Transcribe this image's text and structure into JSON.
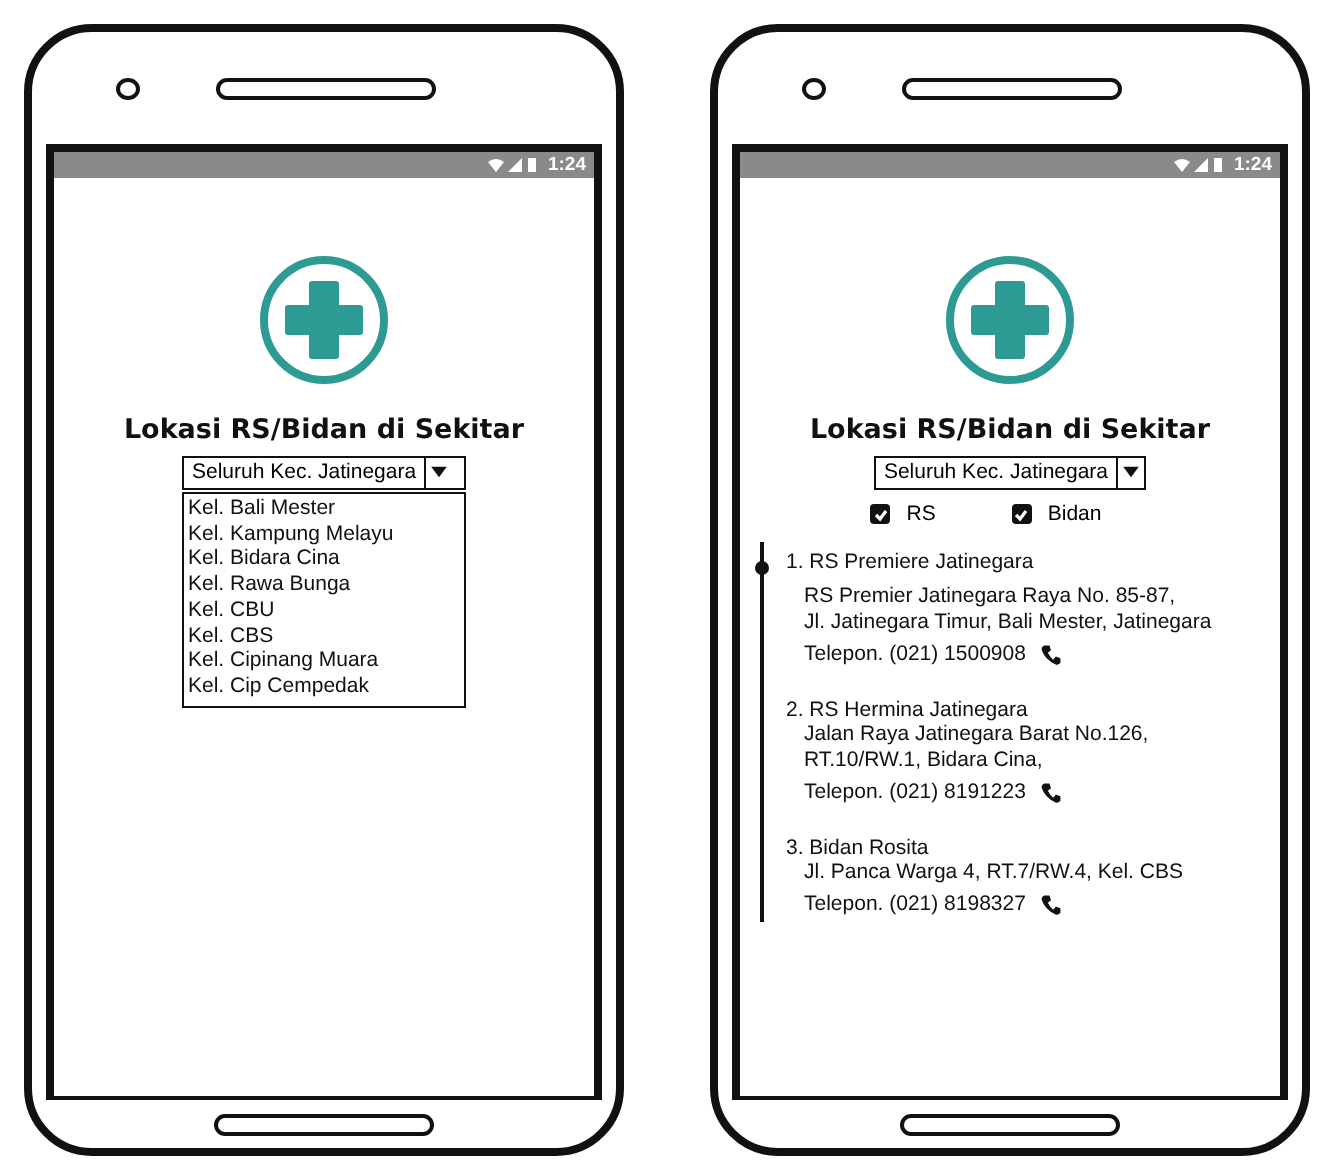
{
  "phones": [
    {
      "status_time": "1:24",
      "title": "Lokasi RS/Bidan di Sekitar",
      "dropdown": {
        "value": "Seluruh Kec. Jatinegara",
        "expanded": true,
        "options": [
          "Kel. Bali Mester",
          "Kel. Kampung Melayu",
          "Kel. Bidara Cina",
          "Kel. Rawa Bunga",
          "Kel. CBU",
          "Kel. CBS",
          "Kel. Cipinang Muara",
          "Kel. Cip Cempedak"
        ]
      }
    },
    {
      "status_time": "1:24",
      "title": "Lokasi RS/Bidan di Sekitar",
      "dropdown": {
        "value": "Seluruh Kec. Jatinegara",
        "expanded": false
      },
      "filters": [
        {
          "label": "RS",
          "checked": true
        },
        {
          "label": "Bidan",
          "checked": true
        }
      ],
      "results": [
        {
          "name": "1. RS Premiere Jatinegara",
          "address_lines": [
            "RS Premier Jatinegara Raya No. 85-87,",
            "Jl. Jatinegara Timur, Bali Mester, Jatinegara"
          ],
          "phone": "Telepon. (021) 1500908"
        },
        {
          "name": "2. RS Hermina Jatinegara",
          "address_lines": [
            "Jalan Raya Jatinegara Barat No.126,",
            "RT.10/RW.1, Bidara Cina,"
          ],
          "phone": "Telepon. (021) 8191223"
        },
        {
          "name": "3. Bidan Rosita",
          "address_lines": [
            "Jl. Panca Warga 4, RT.7/RW.4, Kel. CBS"
          ],
          "phone": "Telepon. (021) 8198327"
        }
      ]
    }
  ]
}
